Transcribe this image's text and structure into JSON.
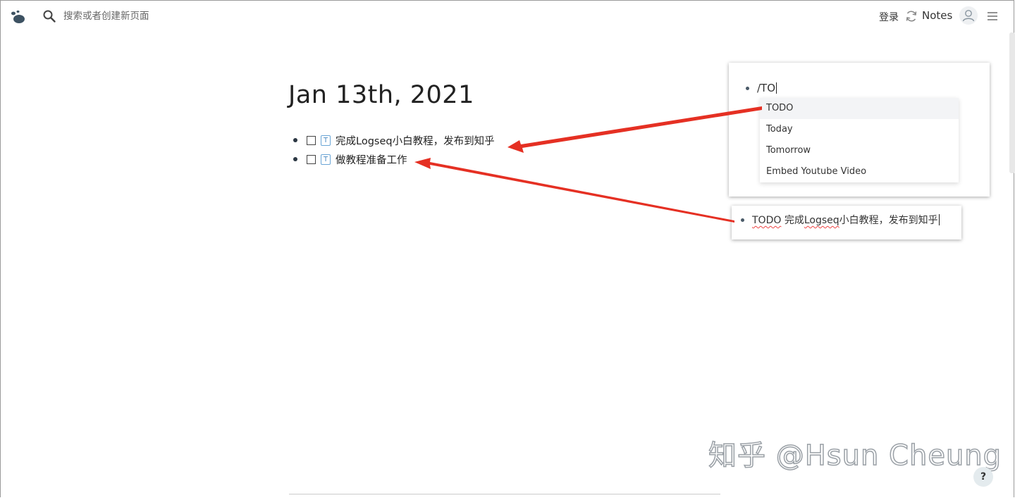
{
  "topbar": {
    "search_placeholder": "搜索或者创建新页面",
    "login_label": "登录",
    "repo_name": "Notes"
  },
  "journal": {
    "title": "Jan 13th, 2021",
    "blocks": [
      {
        "marker": "T",
        "text": "完成Logseq小白教程，发布到知乎"
      },
      {
        "marker": "T",
        "text": "做教程准备工作"
      }
    ]
  },
  "callout_command": {
    "input_text": "/TO",
    "options": [
      "TODO",
      "Today",
      "Tomorrow",
      "Embed Youtube Video"
    ],
    "active_option": "TODO"
  },
  "callout_result": {
    "keyword": "TODO",
    "text_before": " 完成",
    "underlined": "Logseq",
    "text_after": "小白教程，发布到知乎"
  },
  "watermark": "知乎 @Hsun Cheung",
  "help_label": "?",
  "colors": {
    "arrow": "#e53023",
    "accent": "#4a8ac2"
  }
}
